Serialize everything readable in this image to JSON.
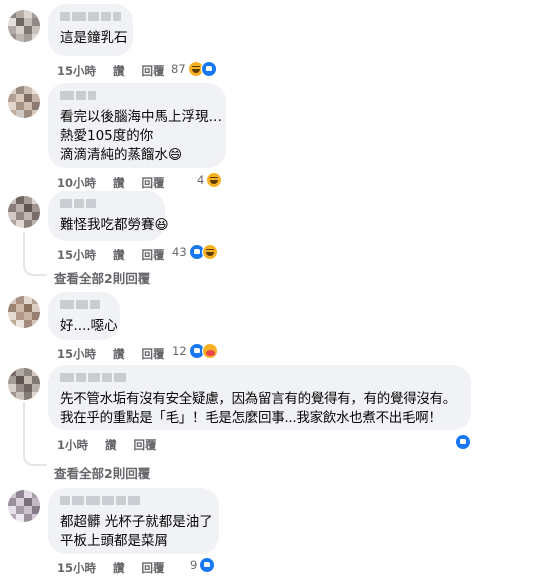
{
  "comments": [
    {
      "lines": [
        "這是鐘乳石"
      ],
      "time": "15小時",
      "like": "讚",
      "reply": "回覆",
      "count": "87",
      "reactions": [
        "haha-icon",
        "like-icon"
      ]
    },
    {
      "lines": [
        "看完以後腦海中馬上浮現…",
        "熱愛105度的你",
        "滴滴清純的蒸餾水😄"
      ],
      "time": "10小時",
      "like": "讚",
      "reply": "回覆",
      "count": "4",
      "reactions": [
        "haha-icon"
      ]
    },
    {
      "lines": [
        "難怪我吃都勞賽😆"
      ],
      "time": "15小時",
      "like": "讚",
      "reply": "回覆",
      "count": "43",
      "reactions": [
        "like-icon",
        "haha-icon"
      ],
      "view_replies": "查看全部2則回覆"
    },
    {
      "lines": [
        "好....噁心"
      ],
      "time": "15小時",
      "like": "讚",
      "reply": "回覆",
      "count": "12",
      "reactions": [
        "like-icon",
        "care-icon"
      ]
    },
    {
      "lines": [
        "先不管水垢有沒有安全疑慮，因為留言有的覺得有，有的覺得沒有。",
        "我在乎的重點是「毛」！毛是怎麼回事...我家飲水也煮不出毛啊！"
      ],
      "time": "1小時",
      "like": "讚",
      "reply": "回覆",
      "count": "",
      "reactions": [
        "like-icon"
      ],
      "view_replies": "查看全部2則回覆"
    },
    {
      "lines": [
        "都超髒 光杯子就都是油了",
        "平板上頭都是菜屑"
      ],
      "time": "15小時",
      "like": "讚",
      "reply": "回覆",
      "count": "9",
      "reactions": [
        "like-icon"
      ]
    }
  ],
  "colors": {
    "bubble": "#f0f2f5",
    "meta": "#65676b",
    "like_blue": "#1877f2",
    "haha_yellow": "#f7b125"
  }
}
